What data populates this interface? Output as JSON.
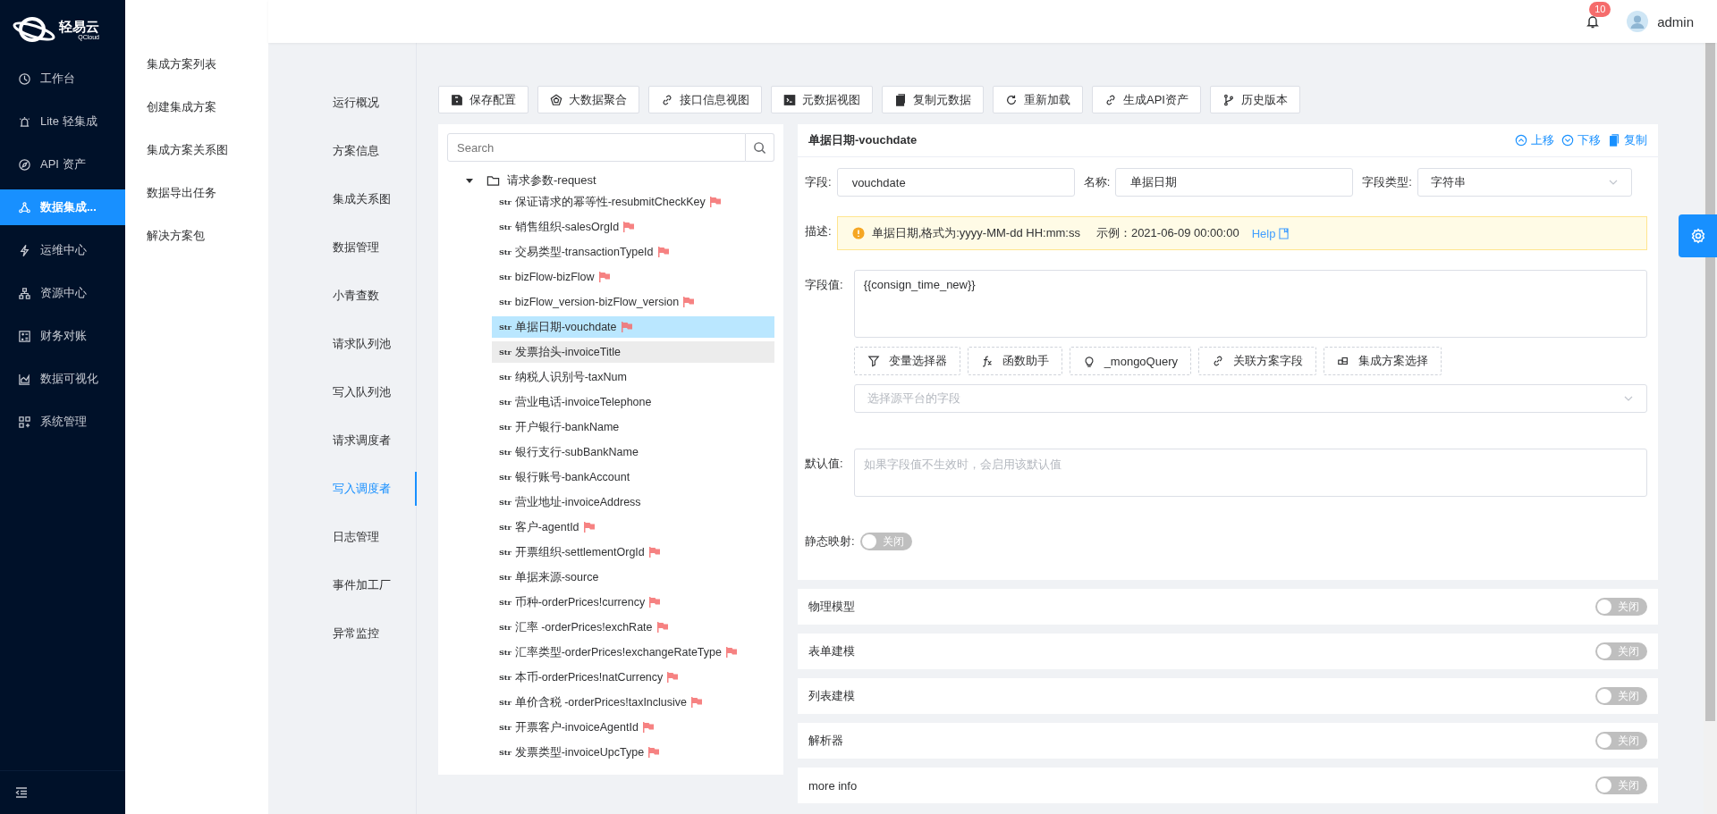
{
  "logo": {
    "name": "轻易云",
    "sub": "QCloud"
  },
  "header": {
    "notifications": "10",
    "user": "admin"
  },
  "sidebar": {
    "items": [
      {
        "label": "工作台",
        "selected": false
      },
      {
        "label": "Lite 轻集成",
        "selected": false
      },
      {
        "label": "API 资产",
        "selected": false
      },
      {
        "label": "数据集成...",
        "selected": true
      },
      {
        "label": "运维中心",
        "selected": false
      },
      {
        "label": "资源中心",
        "selected": false
      },
      {
        "label": "财务对账",
        "selected": false
      },
      {
        "label": "数据可视化",
        "selected": false
      },
      {
        "label": "系统管理",
        "selected": false
      }
    ]
  },
  "submenu": {
    "items": [
      "集成方案列表",
      "创建集成方案",
      "集成方案关系图",
      "数据导出任务",
      "解决方案包"
    ]
  },
  "nav": {
    "items": [
      {
        "label": "运行概况",
        "selected": false
      },
      {
        "label": "方案信息",
        "selected": false
      },
      {
        "label": "集成关系图",
        "selected": false
      },
      {
        "label": "数据管理",
        "selected": false
      },
      {
        "label": "小青查数",
        "selected": false
      },
      {
        "label": "请求队列池",
        "selected": false
      },
      {
        "label": "写入队列池",
        "selected": false
      },
      {
        "label": "请求调度者",
        "selected": false
      },
      {
        "label": "写入调度者",
        "selected": true
      },
      {
        "label": "日志管理",
        "selected": false
      },
      {
        "label": "事件加工厂",
        "selected": false
      },
      {
        "label": "异常监控",
        "selected": false
      }
    ]
  },
  "toolbar": {
    "buttons": [
      "保存配置",
      "大数据聚合",
      "接口信息视图",
      "元数据视图",
      "复制元数据",
      "重新加载",
      "生成API资产",
      "历史版本"
    ]
  },
  "tree": {
    "search": {
      "placeholder": "Search"
    },
    "root": {
      "label": "请求参数-request",
      "expanded": true,
      "children": [
        {
          "tag": "Str",
          "label": "保证请求的幂等性-resubmitCheckKey",
          "flagged": true,
          "selected": false,
          "hovered": false
        },
        {
          "tag": "Str",
          "label": "销售组织-salesOrgId",
          "flagged": true,
          "selected": false,
          "hovered": false
        },
        {
          "tag": "Str",
          "label": "交易类型-transactionTypeId",
          "flagged": true,
          "selected": false,
          "hovered": false
        },
        {
          "tag": "Str",
          "label": "bizFlow-bizFlow",
          "flagged": true,
          "selected": false,
          "hovered": false
        },
        {
          "tag": "Str",
          "label": "bizFlow_version-bizFlow_version",
          "flagged": true,
          "selected": false,
          "hovered": false
        },
        {
          "tag": "Str",
          "label": "单据日期-vouchdate",
          "flagged": true,
          "selected": true,
          "hovered": false
        },
        {
          "tag": "Str",
          "label": "发票抬头-invoiceTitle",
          "flagged": false,
          "selected": false,
          "hovered": true
        },
        {
          "tag": "Str",
          "label": "纳税人识别号-taxNum",
          "flagged": false,
          "selected": false,
          "hovered": false
        },
        {
          "tag": "Str",
          "label": "营业电话-invoiceTelephone",
          "flagged": false,
          "selected": false,
          "hovered": false
        },
        {
          "tag": "Str",
          "label": "开户银行-bankName",
          "flagged": false,
          "selected": false,
          "hovered": false
        },
        {
          "tag": "Str",
          "label": "银行支行-subBankName",
          "flagged": false,
          "selected": false,
          "hovered": false
        },
        {
          "tag": "Str",
          "label": "银行账号-bankAccount",
          "flagged": false,
          "selected": false,
          "hovered": false
        },
        {
          "tag": "Str",
          "label": "营业地址-invoiceAddress",
          "flagged": false,
          "selected": false,
          "hovered": false
        },
        {
          "tag": "Str",
          "label": "客户-agentId",
          "flagged": true,
          "selected": false,
          "hovered": false
        },
        {
          "tag": "Str",
          "label": "开票组织-settlementOrgId",
          "flagged": true,
          "selected": false,
          "hovered": false
        },
        {
          "tag": "Str",
          "label": "单据来源-source",
          "flagged": false,
          "selected": false,
          "hovered": false
        },
        {
          "tag": "Str",
          "label": "币种-orderPrices!currency",
          "flagged": true,
          "selected": false,
          "hovered": false
        },
        {
          "tag": "Str",
          "label": "汇率 -orderPrices!exchRate",
          "flagged": true,
          "selected": false,
          "hovered": false
        },
        {
          "tag": "Str",
          "label": "汇率类型-orderPrices!exchangeRateType",
          "flagged": true,
          "selected": false,
          "hovered": false
        },
        {
          "tag": "Str",
          "label": "本币-orderPrices!natCurrency",
          "flagged": true,
          "selected": false,
          "hovered": false
        },
        {
          "tag": "Str",
          "label": "单价含税 -orderPrices!taxInclusive",
          "flagged": true,
          "selected": false,
          "hovered": false
        },
        {
          "tag": "Str",
          "label": "开票客户-invoiceAgentId",
          "flagged": true,
          "selected": false,
          "hovered": false
        },
        {
          "tag": "Str",
          "label": "发票类型-invoiceUpcType",
          "flagged": true,
          "selected": false,
          "hovered": false
        }
      ]
    }
  },
  "detail": {
    "title": "单据日期-vouchdate",
    "actions": [
      "上移",
      "下移",
      "复制"
    ],
    "field": {
      "label": "字段:",
      "value": "vouchdate"
    },
    "name": {
      "label": "名称:",
      "value": "单据日期"
    },
    "type": {
      "label": "字段类型:",
      "value": "字符串"
    },
    "description": {
      "label": "描述:",
      "text": "单据日期,格式为:yyyy-MM-dd HH:mm:ss",
      "example": "示例：2021-06-09 00:00:00",
      "link": "Help"
    },
    "value": {
      "label": "字段值:",
      "text": "{{consign_time_new}}"
    },
    "helpers": [
      "变量选择器",
      "函数助手",
      "_mongoQuery",
      "关联方案字段",
      "集成方案选择"
    ],
    "source": {
      "placeholder": "选择源平台的字段"
    },
    "default": {
      "label": "默认值:",
      "placeholder": "如果字段值不生效时，会启用该默认值"
    },
    "static_mapping": {
      "label": "静态映射:",
      "on": false,
      "text": "关闭"
    }
  },
  "sections": [
    {
      "title": "物理模型",
      "on": false,
      "text": "关闭"
    },
    {
      "title": "表单建模",
      "on": false,
      "text": "关闭"
    },
    {
      "title": "列表建模",
      "on": false,
      "text": "关闭"
    },
    {
      "title": "解析器",
      "on": false,
      "text": "关闭"
    },
    {
      "title": "more info",
      "on": false,
      "text": "关闭"
    }
  ]
}
